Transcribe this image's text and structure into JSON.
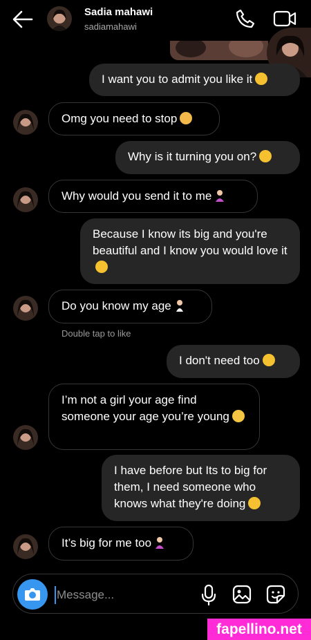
{
  "header": {
    "name": "Sadia mahawi",
    "username": "sadiamahawi"
  },
  "composer": {
    "placeholder": "Message..."
  },
  "messages": [
    {
      "dir": "sent",
      "text": "I want you to admit you like it",
      "emoji": "smirk"
    },
    {
      "dir": "recv",
      "text": "Omg you need to stop",
      "emoji": "flushed"
    },
    {
      "dir": "sent",
      "text": "Why is it turning you on?",
      "emoji": "smirk"
    },
    {
      "dir": "recv",
      "text": "Why would you send it to me",
      "emoji": "person-shrugging"
    },
    {
      "dir": "sent",
      "text": "Because I know its big and you're beautiful and I know you would love it",
      "emoji": "smirk"
    },
    {
      "dir": "recv",
      "text": "Do you know my age",
      "emoji": "person-standing"
    },
    {
      "dir": "sent",
      "text": "I don't need too",
      "emoji": "smirk"
    },
    {
      "dir": "recv",
      "text": "I’m not a girl your age find someone your age you’re young",
      "emoji": "eye-roll"
    },
    {
      "dir": "sent",
      "text": "I have before but Its to big for them, I need someone who knows what they're doing",
      "emoji": "smirk"
    },
    {
      "dir": "recv",
      "text": "It’s big for me too",
      "emoji": "person-shrugging"
    }
  ],
  "hint": "Double tap to like",
  "watermark": "fapellino.net",
  "colors": {
    "accent": "#3797f0",
    "sent_bubble": "#262626",
    "recv_border": "#363636",
    "watermark_bg": "#ff2bd6"
  }
}
